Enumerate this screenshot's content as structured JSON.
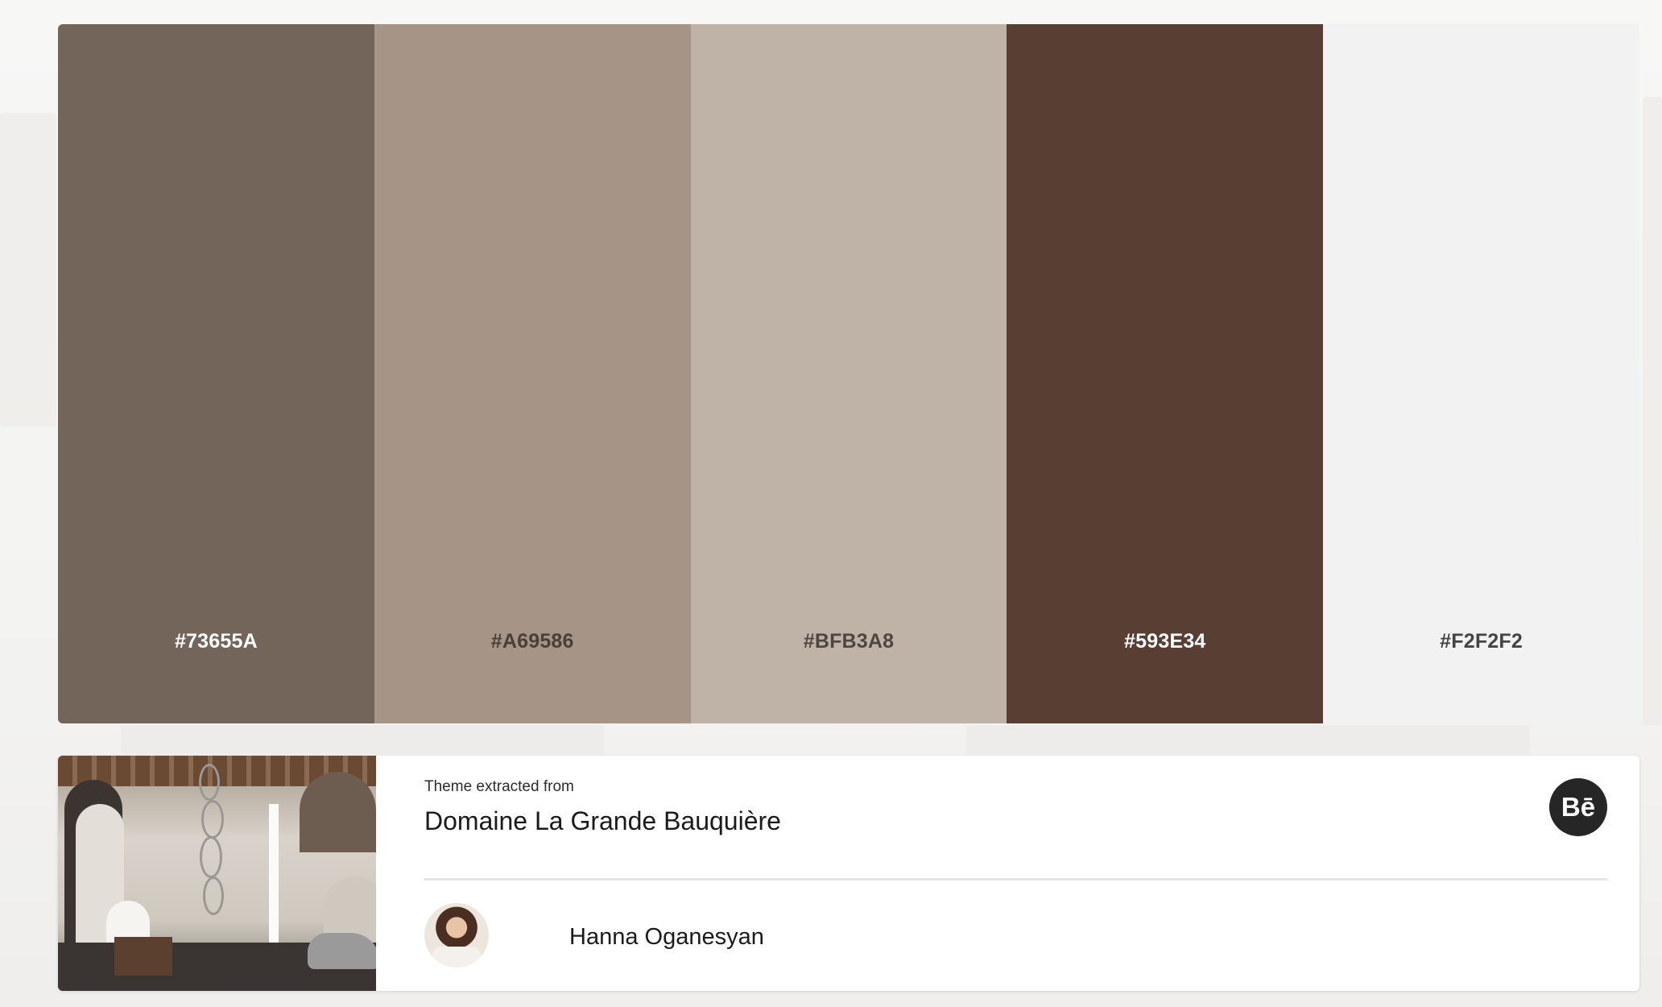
{
  "palette": {
    "swatches": [
      {
        "hex": "#73655A",
        "label": "#73655A",
        "text_color": "#ffffff"
      },
      {
        "hex": "#A69586",
        "label": "#A69586",
        "text_color": "#4a4038"
      },
      {
        "hex": "#BFB3A8",
        "label": "#BFB3A8",
        "text_color": "#4f463f"
      },
      {
        "hex": "#593E34",
        "label": "#593E34",
        "text_color": "#ffffff"
      },
      {
        "hex": "#F2F2F2",
        "label": "#F2F2F2",
        "text_color": "#444444"
      }
    ]
  },
  "theme": {
    "extracted_label": "Theme extracted from",
    "title": "Domaine La Grande Bauquière",
    "source_icon": "behance-icon",
    "source_label": "Bē"
  },
  "author": {
    "name": "Hanna Oganesyan",
    "avatar_icon": "avatar"
  }
}
